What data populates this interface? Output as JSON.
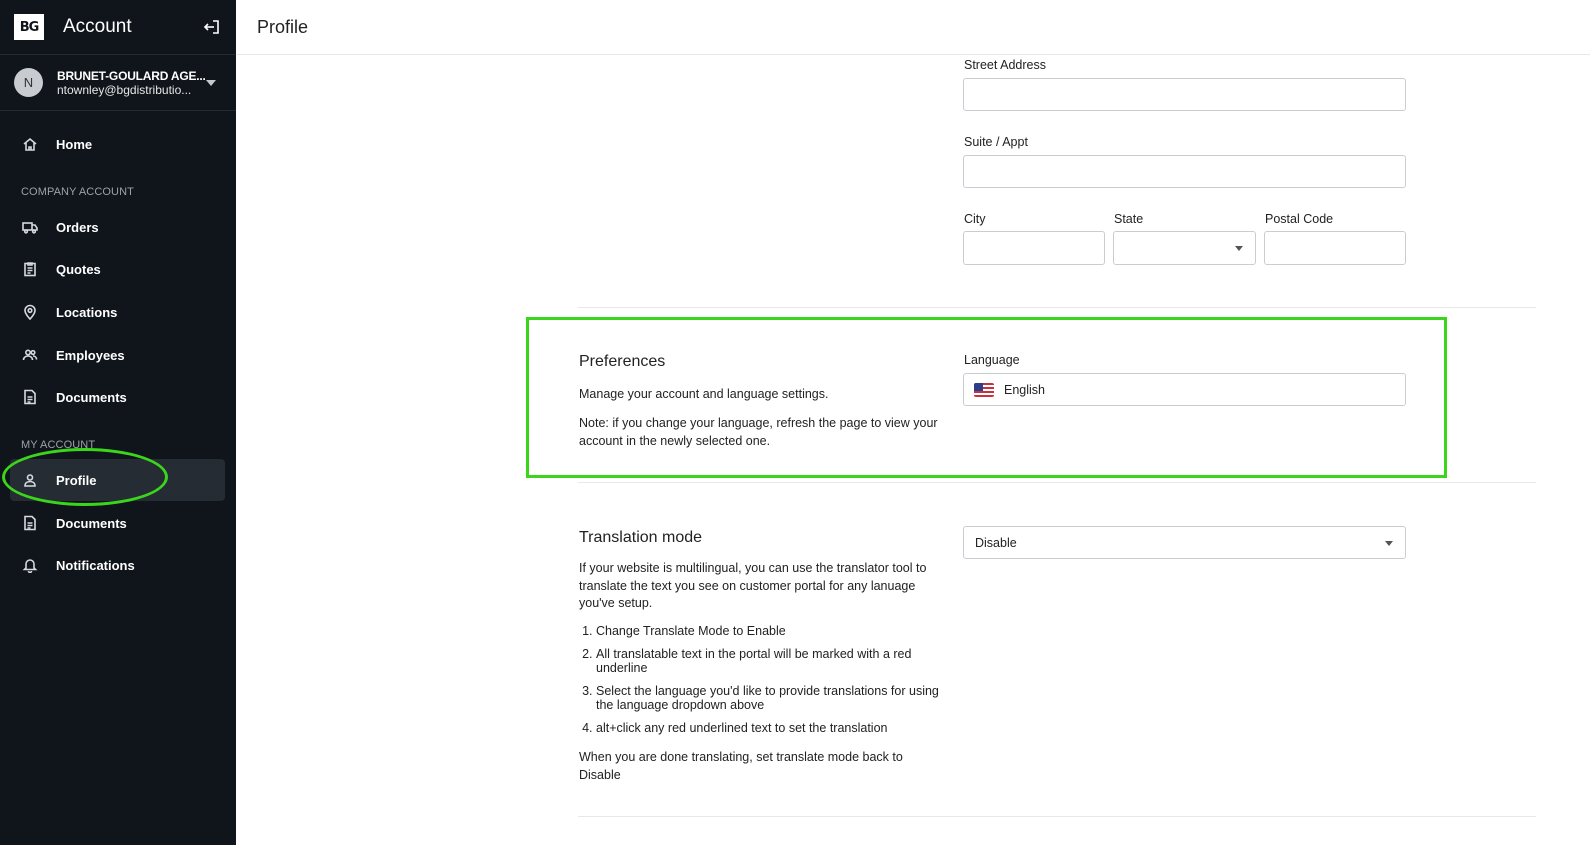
{
  "sidebar": {
    "logo_text": "BG",
    "title": "Account",
    "user": {
      "initial": "N",
      "name": "BRUNET-GOULARD AGE...",
      "email": "ntownley@bgdistributio..."
    },
    "home_label": "Home",
    "company_section": "COMPANY ACCOUNT",
    "company_items": [
      {
        "label": "Orders",
        "icon": "truck-icon"
      },
      {
        "label": "Quotes",
        "icon": "clipboard-icon"
      },
      {
        "label": "Locations",
        "icon": "map-pin-icon"
      },
      {
        "label": "Employees",
        "icon": "users-icon"
      },
      {
        "label": "Documents",
        "icon": "document-icon"
      }
    ],
    "my_section": "MY ACCOUNT",
    "my_items": [
      {
        "label": "Profile",
        "icon": "user-icon",
        "active": true
      },
      {
        "label": "Documents",
        "icon": "document-icon"
      },
      {
        "label": "Notifications",
        "icon": "bell-icon"
      }
    ]
  },
  "header": {
    "title": "Profile"
  },
  "address": {
    "street_label": "Street Address",
    "suite_label": "Suite / Appt",
    "city_label": "City",
    "state_label": "State",
    "postal_label": "Postal Code"
  },
  "preferences": {
    "title": "Preferences",
    "description": "Manage your account and language settings.",
    "note": "Note: if you change your language, refresh the page to view your account in the newly selected one.",
    "language_label": "Language",
    "language_value": "English"
  },
  "translation": {
    "title": "Translation mode",
    "description": "If your website is multilingual, you can use the translator tool to translate the text you see on customer portal for any lanuage you've setup.",
    "steps": [
      "Change Translate Mode to Enable",
      "All translatable text in the portal will be marked with a red underline",
      "Select the language you'd like to provide translations for using the language dropdown above",
      "alt+click any red underlined text to set the translation"
    ],
    "footer": "When you are done translating, set translate mode back to Disable",
    "mode_value": "Disable"
  },
  "colors": {
    "sidebar_bg": "#10151b",
    "highlight": "#3ad61c"
  }
}
